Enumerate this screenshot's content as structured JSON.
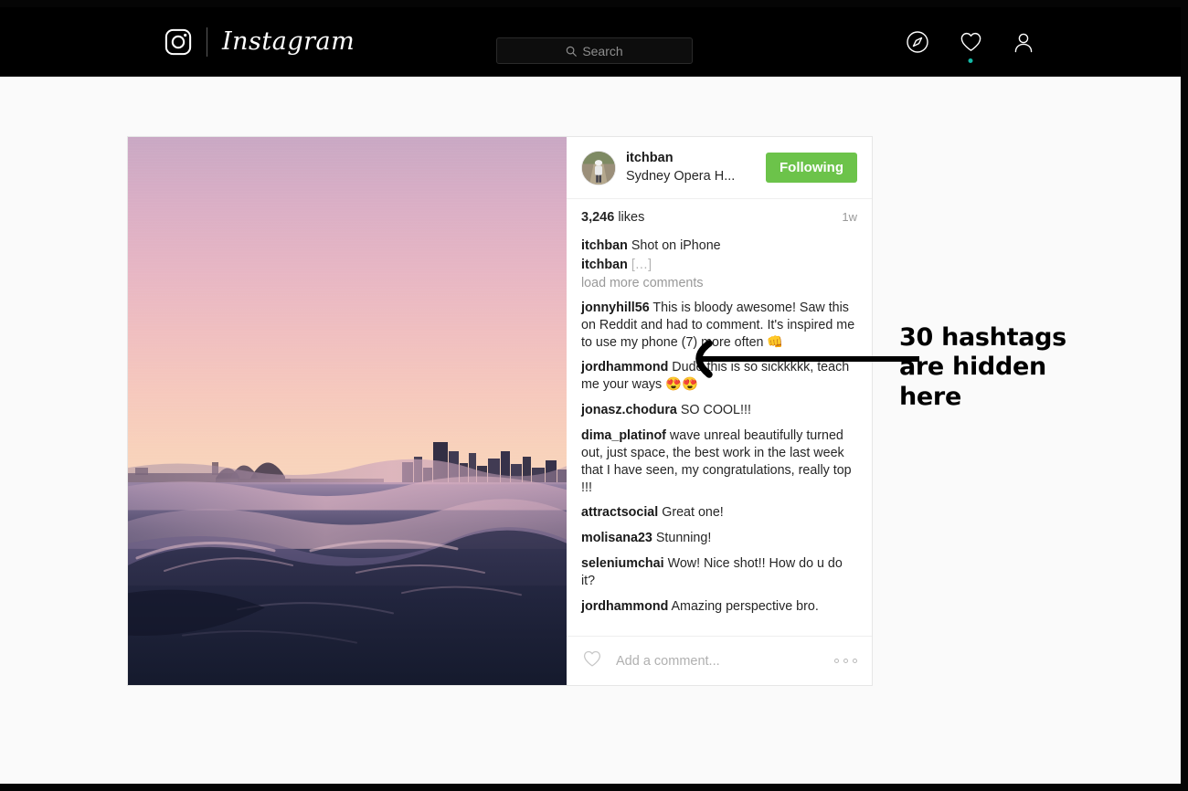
{
  "navbar": {
    "brand_name": "Instagram",
    "brand_icon": "instagram-camera-icon",
    "search": {
      "placeholder": "Search",
      "value": "",
      "icon": "search-icon"
    },
    "icons": [
      {
        "name": "explore-compass-icon",
        "label": "Explore"
      },
      {
        "name": "activity-heart-icon",
        "label": "Activity",
        "has_notification_dot": true
      },
      {
        "name": "profile-person-icon",
        "label": "Profile"
      }
    ],
    "notification_dot_color": "#14b8a6"
  },
  "post": {
    "username": "itchban",
    "location": "Sydney Opera H...",
    "follow_button_label": "Following",
    "follow_button_color": "#6cc34a",
    "likes_count": "3,246",
    "likes_label": "likes",
    "timestamp": "1w",
    "photo": {
      "alt": "Sydney Opera House and city skyline at pink sunset seen low over ocean waves"
    },
    "caption": {
      "username": "itchban",
      "text": "Shot on iPhone"
    },
    "hidden_hashtags_comment": {
      "username": "itchban",
      "text": "[…]"
    },
    "load_more_label": "load more comments",
    "comments": [
      {
        "username": "jonnyhill56",
        "text": "This is bloody awesome! Saw this on Reddit and had to comment. It's inspired me to use my phone (7) more often 👊"
      },
      {
        "username": "jordhammond",
        "text": "Dude this is so sickkkkk, teach me your ways 😍😍"
      },
      {
        "username": "jonasz.chodura",
        "text": "SO COOL!!!"
      },
      {
        "username": "dima_platinof",
        "text": "wave unreal beautifully turned out, just space, the best work in the last week that I have seen, my congratulations, really top !!!"
      },
      {
        "username": "attractsocial",
        "text": "Great one!"
      },
      {
        "username": "molisana23",
        "text": "Stunning!"
      },
      {
        "username": "seleniumchai",
        "text": "Wow! Nice shot!! How do u do it?"
      },
      {
        "username": "jordhammond",
        "text": "Amazing perspective bro."
      }
    ],
    "footer": {
      "like_icon": "heart-outline-icon",
      "comment_placeholder": "Add a comment...",
      "more_options_icon": "three-dots-icon"
    }
  },
  "annotation": {
    "line1": "30 hashtags",
    "line2": "are hidden",
    "line3": "here",
    "arrow_icon": "left-arrow-annotation"
  }
}
